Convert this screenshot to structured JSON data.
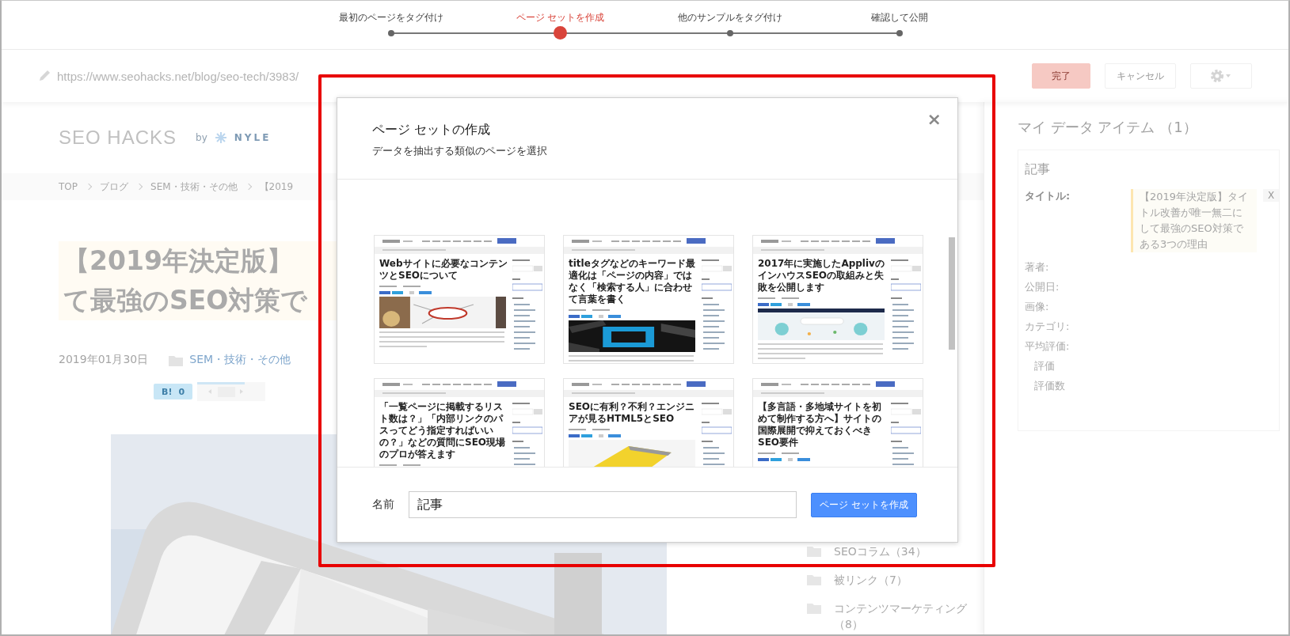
{
  "steps": [
    {
      "label": "最初のページをタグ付け",
      "selected": false
    },
    {
      "label": "ページ セットを作成",
      "selected": true
    },
    {
      "label": "他のサンプルをタグ付け",
      "selected": false
    },
    {
      "label": "確認して公開",
      "selected": false
    }
  ],
  "toolbar": {
    "url": "https://www.seohacks.net/blog/seo-tech/3983/",
    "buttons": [
      {
        "label": "完了",
        "kind": "primary"
      },
      {
        "label": "キャンセル",
        "kind": "default"
      }
    ]
  },
  "page": {
    "logo": {
      "name": "SEO HACKS",
      "by": "by",
      "brand": "NYLE"
    },
    "breadcrumb": [
      "TOP",
      "ブログ",
      "SEM・技術・その他",
      "【2019"
    ],
    "title_lines": [
      "【2019年決定版】",
      "て最強のSEO対策で"
    ],
    "date": "2019年01月30日",
    "category": "SEM・技術・その他",
    "bookmark": {
      "label": "B!",
      "count": "0"
    },
    "hero": {
      "kind": "picture"
    },
    "categories": [
      {
        "label": "SEOコラム（34）"
      },
      {
        "label": "被リンク（7）"
      },
      {
        "label": "コンテンツマーケティング（8）"
      }
    ]
  },
  "data_panel": {
    "title": "マイ データ アイテム （1）",
    "card": {
      "title": "記事",
      "fields": [
        {
          "label": "タイトル:",
          "value": "【2019年決定版】タイトル改善が唯一無二にして最強のSEO対策である3つの理由",
          "remove": "X"
        },
        {
          "label": "著者:"
        },
        {
          "label": "公開日:"
        },
        {
          "label": "画像:"
        },
        {
          "label": "カテゴリ:"
        },
        {
          "label": "平均評価:",
          "children": [
            {
              "label": "評価"
            },
            {
              "label": "評価数"
            }
          ]
        }
      ]
    }
  },
  "dialog": {
    "title": "ページ セットの作成",
    "subtitle": "データを抽出する類似のページを選択",
    "close": "×",
    "pages": [
      {
        "title": "Webサイトに必要なコンテンツとSEOについて",
        "image": {
          "kind": "picture"
        }
      },
      {
        "title": "titleタグなどのキーワード最適化は「ページの内容」ではなく「検索する人」に合わせて言葉を書く",
        "image": {
          "kind": "picture"
        }
      },
      {
        "title": "2017年に実施したApplivのインハウスSEOの取組みと失敗を公開します",
        "image": {
          "kind": "picture"
        }
      },
      {
        "title": "「一覧ページに掲載するリスト数は？」「内部リンクのパスってどう指定すればいいの？」などの質問にSEO現場のプロが答えます"
      },
      {
        "title": "SEOに有利？不利？エンジニアが見るHTML5とSEO",
        "image": {
          "kind": "picture"
        }
      },
      {
        "title": "【多言語・多地域サイトを初めて制作する方へ】サイトの国際展開で抑えておくべきSEO要件"
      }
    ],
    "name_label": "名前",
    "name_value": "記事",
    "submit": "ページ セットを作成"
  },
  "highlight_frame": true
}
